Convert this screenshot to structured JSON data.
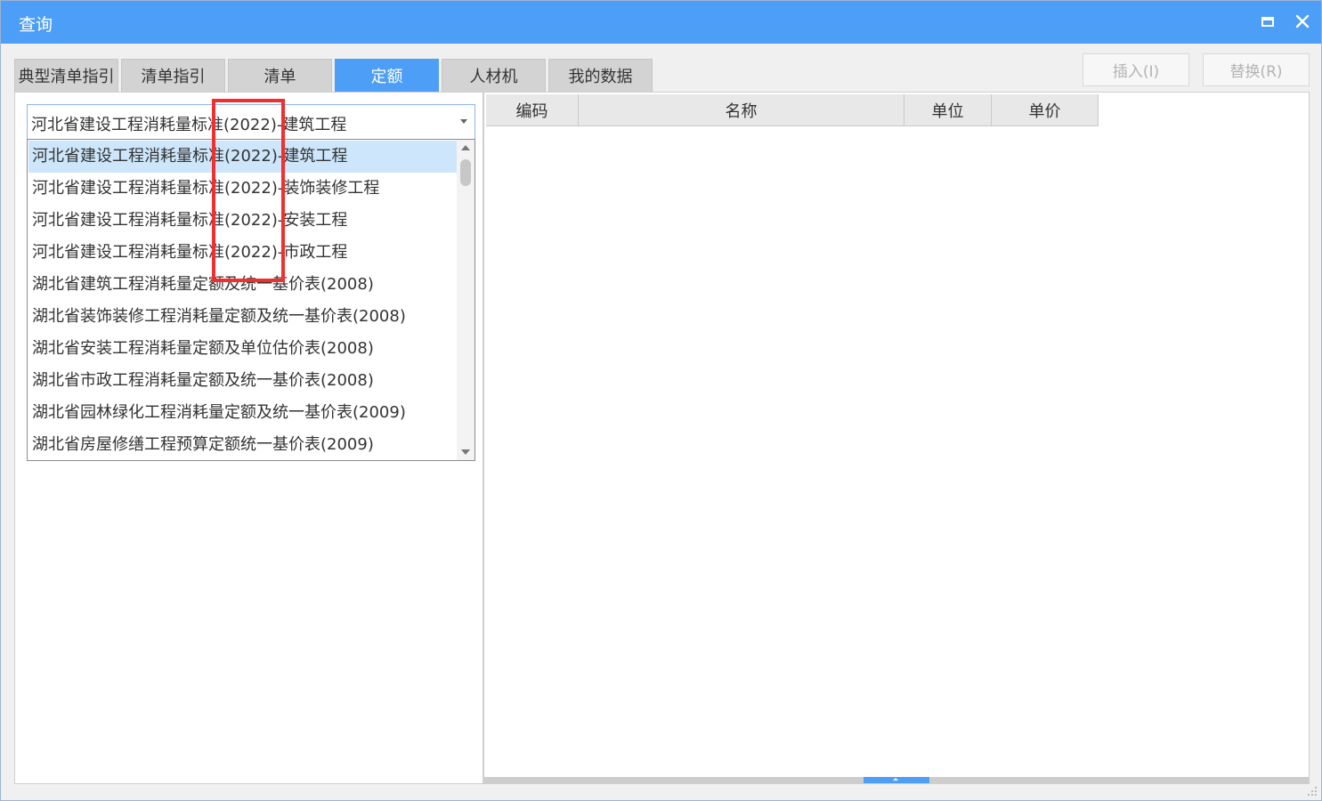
{
  "window": {
    "title": "查询"
  },
  "tabs": [
    {
      "label": "典型清单指引",
      "active": false
    },
    {
      "label": "清单指引",
      "active": false
    },
    {
      "label": "清单",
      "active": false
    },
    {
      "label": "定额",
      "active": true
    },
    {
      "label": "人材机",
      "active": false
    },
    {
      "label": "我的数据",
      "active": false
    }
  ],
  "actions": {
    "insert_label": "插入(I)",
    "replace_label": "替换(R)"
  },
  "combo": {
    "value": "河北省建设工程消耗量标准(2022)-建筑工程"
  },
  "dropdown": {
    "items": [
      "河北省建设工程消耗量标准(2022)-建筑工程",
      "河北省建设工程消耗量标准(2022)-装饰装修工程",
      "河北省建设工程消耗量标准(2022)-安装工程",
      "河北省建设工程消耗量标准(2022)-市政工程",
      "湖北省建筑工程消耗量定额及统一基价表(2008)",
      "湖北省装饰装修工程消耗量定额及统一基价表(2008)",
      "湖北省安装工程消耗量定额及单位估价表(2008)",
      "湖北省市政工程消耗量定额及统一基价表(2008)",
      "湖北省园林绿化工程消耗量定额及统一基价表(2009)",
      "湖北省房屋修缮工程预算定额统一基价表(2009)"
    ],
    "selected_index": 0
  },
  "table": {
    "headers": [
      "编码",
      "名称",
      "单位",
      "单价"
    ]
  },
  "colors": {
    "accent": "#4d9ef6",
    "highlight_box": "#f0302f",
    "selected_row": "#cde6fb"
  }
}
